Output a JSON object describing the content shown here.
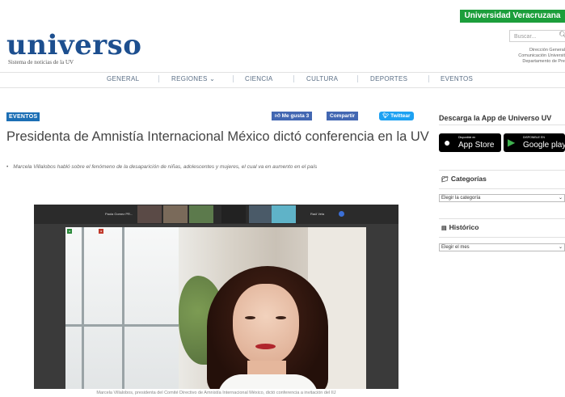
{
  "header": {
    "badge": "Universidad Veracruzana",
    "logo": "universo",
    "logo_sub": "Sistema de noticias de la UV",
    "search_placeholder": "Buscar...",
    "dept_lines": [
      "Dirección General",
      "Comunicación Universit",
      "Departamento de Pre"
    ]
  },
  "nav": {
    "items": [
      "GENERAL",
      "REGIONES",
      "CIENCIA",
      "CULTURA",
      "DEPORTES",
      "EVENTOS"
    ]
  },
  "article": {
    "tag": "EVENTOS",
    "social": {
      "like": "Me gusta 3",
      "share": "Compartir",
      "tweet": "Twittear"
    },
    "title": "Presidenta de Amnistía Internacional México dictó conferencia en la UV",
    "summary": "Marcela Villalobos habló sobre el fenómeno de la desaparición de niñas, adolescentes y mujeres, el cual va en aumento en el país",
    "photo": {
      "strip_names": [
        "Paola Gomez PR...",
        "Raúl Vela"
      ],
      "caption": "Marcela Villalobos, presidenta del Comité Directivo de Amnistía Internacional México, dictó conferencia a invitación del IIJ"
    }
  },
  "sidebar": {
    "app_heading": "Descarga la App de Universo UV",
    "app_store": {
      "small": "Disponible en",
      "big": "App Store"
    },
    "google_play": {
      "small": "DISPONIBLE EN",
      "big": "Google play"
    },
    "categories": {
      "heading": "Categorías",
      "select": "Elegir la categoría"
    },
    "history": {
      "heading": "Histórico",
      "select": "Elegir el mes"
    }
  },
  "colors": {
    "badge": "#1c9e3b",
    "logo": "#1d4f8f",
    "tag": "#1c6fb5",
    "facebook": "#4267b2",
    "twitter": "#1da1f2"
  }
}
